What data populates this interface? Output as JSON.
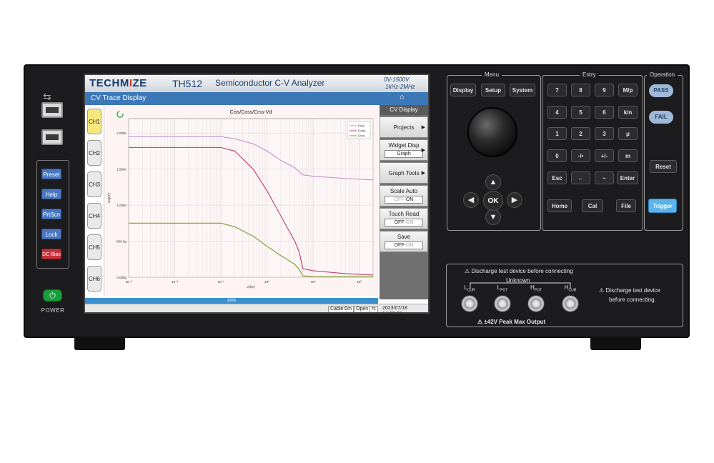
{
  "brand": {
    "prefix": "TECHM",
    "accent": "I",
    "suffix": "ZE"
  },
  "header": {
    "model": "TH512",
    "product": "Semiconductor C-V Analyzer",
    "spec_voltage": "0V-1500V",
    "spec_freq": "1kHz-2MHz"
  },
  "title_bar": {
    "title": "CV Trace Display",
    "home_icon": "home-icon"
  },
  "channels": [
    "CH1",
    "CH2",
    "CH3",
    "CH4",
    "CH5",
    "CH6"
  ],
  "active_channel": "CH1",
  "sidebar": {
    "header": "CV Display",
    "projects": "Projects",
    "widget_disp": "Widget Disp",
    "widget_disp_value": "Graph",
    "graph_tools": "Graph Tools",
    "scale_auto": "Scale Auto",
    "scale_auto_off": "OFF",
    "scale_auto_on": "ON",
    "touch_read": "Touch Read",
    "touch_read_off": "OFF",
    "touch_read_on": "ON",
    "save": "Save",
    "save_off": "OFF",
    "save_on": "ON"
  },
  "progress": {
    "label": "100%",
    "fraction": 1.0
  },
  "status": {
    "cable": "Cable:0m",
    "open": "Open",
    "datetime": "2023/07/18 14:02:02"
  },
  "left_keys": {
    "preset": "Preset",
    "help": "Help",
    "prtscn": "PrtScn",
    "lock": "Lock",
    "dc_bias": "DC Bias"
  },
  "power": {
    "label": "POWER",
    "icon": "power-icon"
  },
  "menu_panel": {
    "title": "Menu",
    "display": "Display",
    "setup": "Setup",
    "system": "System"
  },
  "entry_panel": {
    "title": "Entry",
    "keys": [
      "7",
      "8",
      "9",
      "M/p",
      "4",
      "5",
      "6",
      "k/n",
      "1",
      "2",
      "3",
      "μ",
      "0",
      "·/•",
      "+/-",
      "m"
    ],
    "esc": "Esc",
    "back_icon": "←",
    "tilde": "~",
    "enter": "Enter",
    "home": "Home",
    "cal": "Cal",
    "file": "File"
  },
  "nav": {
    "up": "▲",
    "down": "▼",
    "left": "◀",
    "right": "▶",
    "ok": "OK"
  },
  "operation_panel": {
    "title": "Operation",
    "pass": "PASS",
    "fail": "FAIL",
    "reset": "Reset",
    "trigger": "Trigger"
  },
  "terminals": {
    "warn_top": "⚠ Discharge test device before connecting",
    "unknown": "Unknown",
    "labels": [
      {
        "main": "L",
        "sub": "CUR"
      },
      {
        "main": "L",
        "sub": "POT"
      },
      {
        "main": "H",
        "sub": "POT"
      },
      {
        "main": "H",
        "sub": "CUR"
      }
    ],
    "warn_side_1": "⚠  Discharge test device",
    "warn_side_2": "before connecting.",
    "warn_bottom": "⚠ ±42V Peak Max Output"
  },
  "colors": {
    "screen_blue": "#3c78b7",
    "ciss": "#c48fd0",
    "coss": "#c0386a",
    "crss": "#7a9a2c",
    "accent_red": "#d2362f",
    "power_green": "#1a9e3a"
  },
  "chart_data": {
    "type": "line",
    "title": "Ciss/Coss/Crss-Vd",
    "xlabel": "Vd(V)",
    "ylabel": "Cap(F)",
    "x_scale": "log",
    "xlim": [
      0.001,
      200
    ],
    "ylim": [
      0,
      2.2e-09
    ],
    "xticks": [
      "10⁻³",
      "10⁻²",
      "10⁻¹",
      "10⁰",
      "10¹",
      "10²"
    ],
    "yticks": [
      "0.000p",
      "500.0p",
      "1.000n",
      "1.500n",
      "2.000n"
    ],
    "ytick_values": [
      0,
      5e-10,
      1e-09,
      1.5e-09,
      2e-09
    ],
    "grid": true,
    "legend": "top-right",
    "series": [
      {
        "name": "Ciss",
        "x": [
          0.001,
          0.1,
          0.2,
          0.5,
          1,
          2,
          4,
          6,
          10,
          50,
          200
        ],
        "y": [
          1.95e-09,
          1.95e-09,
          1.92e-09,
          1.85e-09,
          1.75e-09,
          1.62e-09,
          1.52e-09,
          1.42e-09,
          1.4e-09,
          1.37e-09,
          1.35e-09
        ]
      },
      {
        "name": "Coss",
        "x": [
          0.001,
          0.1,
          0.2,
          0.5,
          1,
          2,
          4,
          5,
          6,
          10,
          50,
          200
        ],
        "y": [
          1.8e-09,
          1.8e-09,
          1.75e-09,
          1.5e-09,
          1.2e-09,
          8.5e-10,
          5e-10,
          3.5e-10,
          1.2e-10,
          9e-11,
          5e-11,
          3e-11
        ]
      },
      {
        "name": "Crss",
        "x": [
          0.001,
          0.1,
          0.2,
          0.5,
          1,
          2,
          4,
          5,
          6,
          10,
          200
        ],
        "y": [
          7.5e-10,
          7.5e-10,
          7e-10,
          5.7e-10,
          4.3e-10,
          3e-10,
          1.8e-10,
          1.1e-10,
          2e-11,
          1e-11,
          5e-12
        ]
      }
    ]
  }
}
